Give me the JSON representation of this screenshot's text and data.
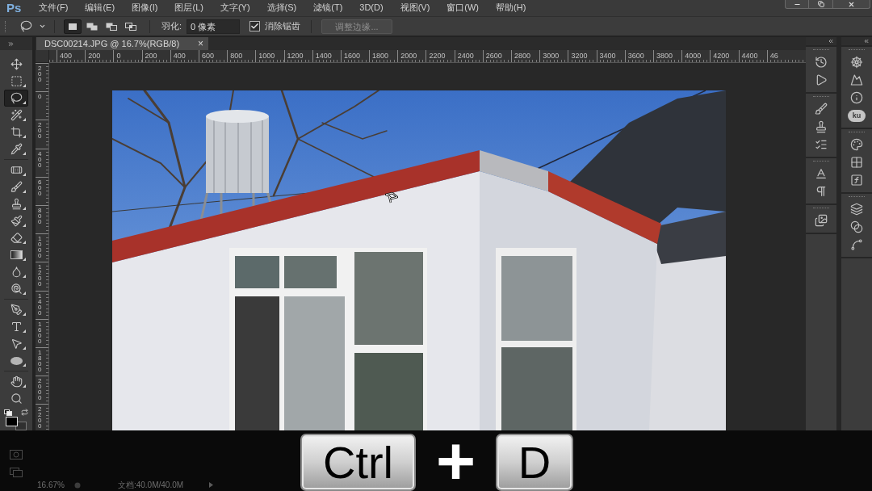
{
  "menu_bar": {
    "logo": "Ps",
    "items": [
      "文件(F)",
      "编辑(E)",
      "图像(I)",
      "图层(L)",
      "文字(Y)",
      "选择(S)",
      "滤镜(T)",
      "3D(D)",
      "视图(V)",
      "窗口(W)",
      "帮助(H)"
    ]
  },
  "options_bar": {
    "selection_modes": [
      {
        "kind": "new",
        "selected": true
      },
      {
        "kind": "add",
        "selected": false
      },
      {
        "kind": "subtract",
        "selected": false
      },
      {
        "kind": "intersect",
        "selected": false
      }
    ],
    "feather": {
      "label": "羽化:",
      "value": "0 像素"
    },
    "anti_alias": {
      "label": "消除锯齿",
      "checked": true
    },
    "refine_edge": {
      "label": "调整边缘...",
      "disabled": true
    }
  },
  "document_tab": {
    "title": "DSC00214.JPG @ 16.7%(RGB/8)",
    "close": "×"
  },
  "rulers": {
    "horizontal": [
      "400",
      "200",
      "0",
      "200",
      "400",
      "600",
      "800",
      "1000",
      "1200",
      "1400",
      "1600",
      "1800",
      "2000",
      "2200",
      "2400",
      "2600",
      "2800",
      "3000",
      "3200",
      "3400",
      "3600",
      "3800",
      "4000",
      "4200",
      "4400",
      "46"
    ],
    "vertical": [
      "200",
      "0",
      "200",
      "400",
      "600",
      "800",
      "1000",
      "1200",
      "1400",
      "1600",
      "1800",
      "2000",
      "2200"
    ]
  },
  "tools": [
    {
      "kind": "move",
      "selected": false
    },
    {
      "kind": "marquee",
      "selected": false
    },
    {
      "kind": "lasso",
      "selected": true
    },
    {
      "kind": "quick_select",
      "selected": false
    },
    {
      "kind": "crop",
      "selected": false
    },
    {
      "kind": "eyedropper",
      "selected": false
    },
    {
      "kind": "healing",
      "selected": false
    },
    {
      "kind": "brush",
      "selected": false
    },
    {
      "kind": "stamp",
      "selected": false
    },
    {
      "kind": "history_brush",
      "selected": false
    },
    {
      "kind": "eraser",
      "selected": false
    },
    {
      "kind": "gradient",
      "selected": false
    },
    {
      "kind": "blur",
      "selected": false
    },
    {
      "kind": "dodge",
      "selected": false
    },
    {
      "kind": "pen",
      "selected": false
    },
    {
      "kind": "type",
      "selected": false
    },
    {
      "kind": "path_select",
      "selected": false
    },
    {
      "kind": "shape",
      "selected": false
    },
    {
      "kind": "hand",
      "selected": false
    },
    {
      "kind": "zoom",
      "selected": false
    }
  ],
  "dock": {
    "kuler_label": "ku"
  },
  "status_bar": {
    "zoom": "16.67%",
    "document": "文档:40.0M/40.0M"
  },
  "shortcut_overlay": {
    "keys": [
      "Ctrl",
      "D"
    ],
    "joiner": "+"
  }
}
